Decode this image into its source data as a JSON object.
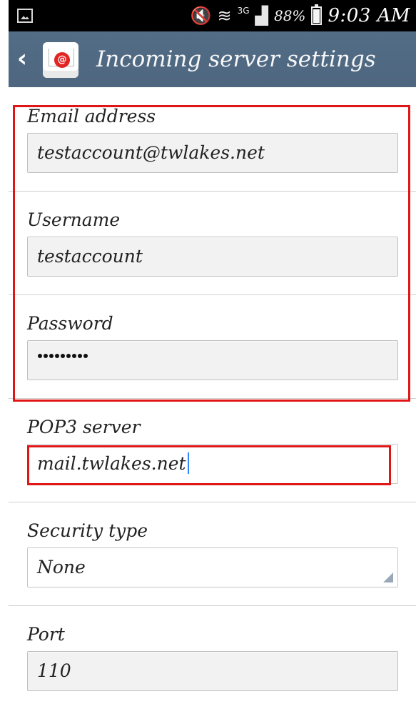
{
  "status_bar": {
    "network_label": "3G",
    "battery_text": "88%",
    "time": "9:03 AM",
    "icons": [
      "gallery-icon",
      "mute-icon",
      "wifi-icon",
      "signal-icon",
      "battery-icon"
    ]
  },
  "header": {
    "title": "Incoming server settings",
    "back_icon": "back-arrow-icon",
    "app_icon": "email-app-icon",
    "accent_color": "#536d87"
  },
  "form": {
    "email": {
      "label": "Email address",
      "value": "testaccount@twlakes.net"
    },
    "username": {
      "label": "Username",
      "value": "testaccount"
    },
    "password": {
      "label": "Password",
      "masked_length": 9
    },
    "pop3_server": {
      "label": "POP3 server",
      "value": "mail.twlakes.net"
    },
    "security_type": {
      "label": "Security type",
      "value": "None"
    },
    "port": {
      "label": "Port",
      "value": "110"
    }
  },
  "annotations": {
    "highlight_color": "#e01616"
  }
}
